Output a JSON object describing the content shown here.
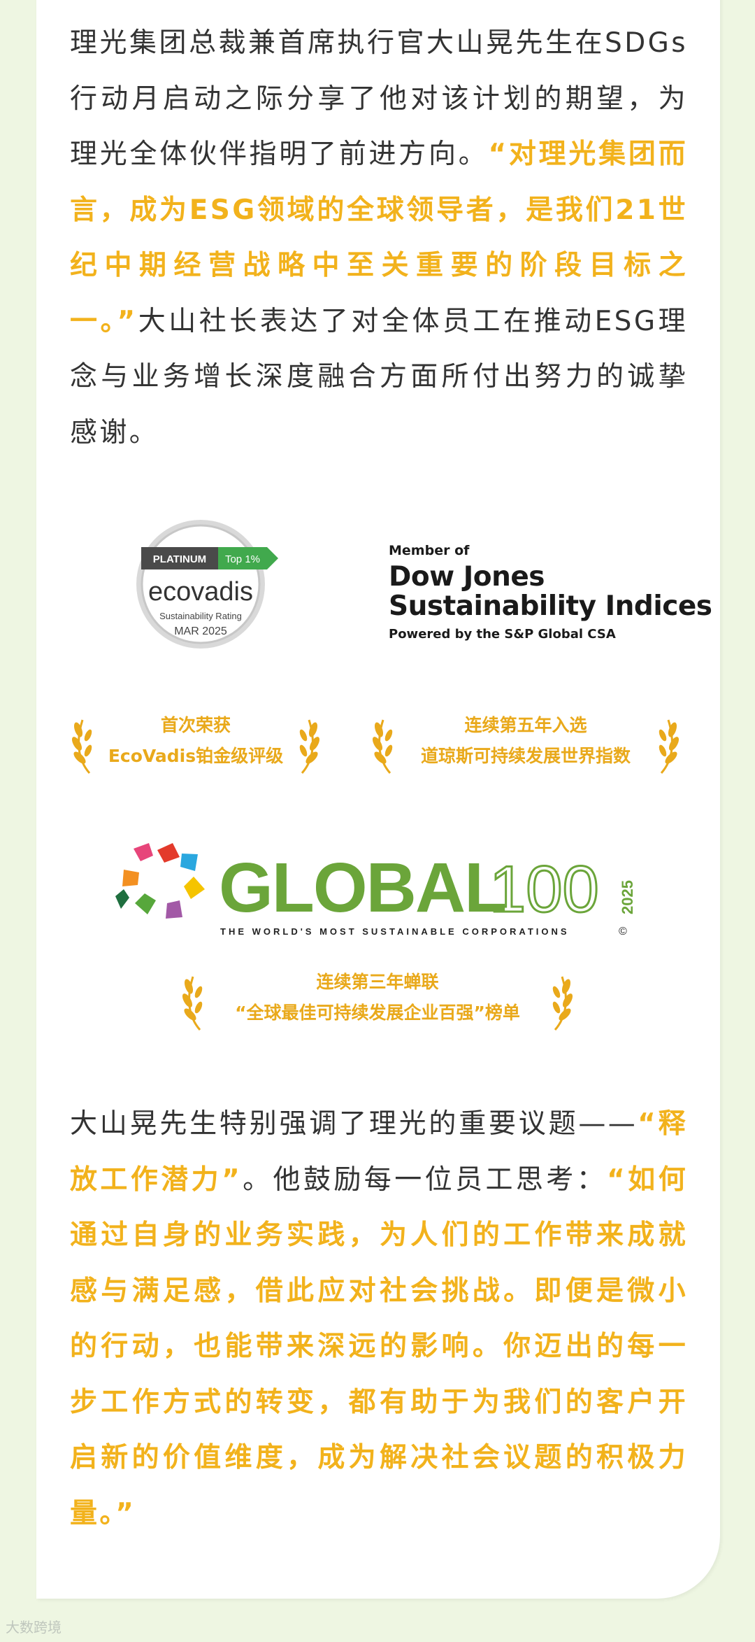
{
  "para1": {
    "normal_1": "理光集团总裁兼首席执行官大山晃先生在SDGs行动月启动之际分享了他对该计划的期望，为理光全体伙伴指明了前进方向。",
    "quote": "“对理光集团而言，成为ESG领域的全球领导者，是我们21世纪中期经营战略中至关重要的阶段目标之一。”",
    "normal_2": "大山社长表达了对全体员工在推动ESG理念与业务增长深度融合方面所付出努力的诚挚感谢。"
  },
  "ecovadis": {
    "platinum": "PLATINUM",
    "top": "Top 1%",
    "brand": "ecovadis",
    "rating": "Sustainability Rating",
    "date": "MAR 2025"
  },
  "dowjones": {
    "member": "Member of",
    "line1": "Dow Jones",
    "line2": "Sustainability Indices",
    "powered": "Powered by the S&P Global CSA"
  },
  "awards": {
    "a1_line1": "首次荣获",
    "a1_line2": "EcoVadis铂金级评级",
    "a2_line1": "连续第五年入选",
    "a2_line2": "道琼斯可持续发展世界指数",
    "a3_line1": "连续第三年蝉联",
    "a3_line2": "“全球最佳可持续发展企业百强”榜单"
  },
  "global100": {
    "word": "GLOBAL",
    "num": "100",
    "year": "2025",
    "tagline": "THE WORLD'S MOST SUSTAINABLE CORPORATIONS",
    "copyright": "©"
  },
  "para2": {
    "normal_1": "大山晃先生特别强调了理光的重要议题——",
    "topic": "“释放工作潜力”",
    "normal_2": "。他鼓励每一位员工思考：",
    "quote": "“如何通过自身的业务实践，为人们的工作带来成就感与满足感，借此应对社会挑战。即便是微小的行动，也能带来深远的影响。你迈出的每一步工作方式的转变，都有助于为我们的客户开启新的价值维度，成为解决社会议题的积极力量。”"
  },
  "watermark": "大数跨境",
  "colors": {
    "accent": "#f2b21c",
    "green": "#6ba53a",
    "background": "#eef6e2"
  }
}
